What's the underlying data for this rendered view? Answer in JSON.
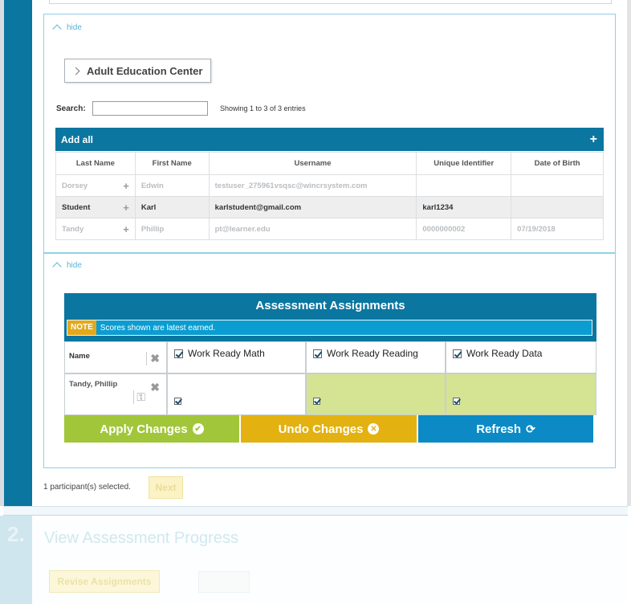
{
  "section1": {
    "hide_label": "hide",
    "org_button": "Adult Education Center",
    "search_label": "Search:",
    "search_value": "",
    "entries_text": "Showing 1 to 3 of 3 entries",
    "add_all_label": "Add all",
    "add_all_icon": "plus-icon",
    "columns": [
      "Last Name",
      "First Name",
      "Username",
      "Unique Identifier",
      "Date of Birth"
    ],
    "rows": [
      {
        "last": "Dorsey",
        "first": "Edwin",
        "username": "testuser_275961vsqsc@wincrsystem.com",
        "uid": "",
        "dob": "",
        "state": "dim"
      },
      {
        "last": "Student",
        "first": "Karl",
        "username": "karlstudent@gmail.com",
        "uid": "karl1234",
        "dob": "",
        "state": "selected"
      },
      {
        "last": "Tandy",
        "first": "Phillip",
        "username": "pt@learner.edu",
        "uid": "0000000002",
        "dob": "07/19/2018",
        "state": "dim"
      }
    ]
  },
  "section2": {
    "hide_label": "hide",
    "title": "Assessment Assignments",
    "note_tag": "NOTE",
    "note_text": "Scores shown are latest earned.",
    "name_header": "Name",
    "assessments": [
      "Work Ready Math",
      "Work Ready Reading",
      "Work Ready Data"
    ],
    "student": "Tandy, Phillip",
    "apply_label": "Apply Changes",
    "undo_label": "Undo Changes",
    "refresh_label": "Refresh",
    "colors": {
      "apply": "#a1c63a",
      "undo": "#e3b110",
      "refresh": "#0b8ac6",
      "assigned_cell": "#d4e493"
    }
  },
  "footer": {
    "selected_text": "1 participant(s) selected.",
    "next_label": "Next"
  },
  "step2": {
    "number": "2.",
    "title": "View Assessment Progress",
    "revise_label": "Revise Assignments"
  },
  "theme": {
    "primary": "#0b76a0",
    "accent_border": "#8fd0e6"
  }
}
